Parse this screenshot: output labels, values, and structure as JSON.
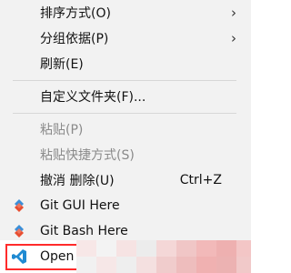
{
  "menu": {
    "items": [
      {
        "label": "排序方式(O)",
        "has_submenu": true
      },
      {
        "label": "分组依据(P)",
        "has_submenu": true
      },
      {
        "label": "刷新(E)"
      },
      {
        "label": "自定义文件夹(F)..."
      },
      {
        "label": "粘贴(P)",
        "disabled": true
      },
      {
        "label": "粘贴快捷方式(S)",
        "disabled": true
      },
      {
        "label": "撤消 删除(U)",
        "shortcut": "Ctrl+Z"
      },
      {
        "label": "Git GUI Here",
        "icon": "git-icon"
      },
      {
        "label": "Git Bash Here",
        "icon": "git-icon"
      },
      {
        "label": "Open",
        "icon": "vscode-icon"
      }
    ],
    "arrow_glyph": "›"
  },
  "colors": {
    "menu_bg": "#f2f2f2",
    "text": "#111111",
    "disabled_text": "#8a8a8a",
    "highlight_border": "#ff2b2b",
    "vscode_blue": "#1f8ad2",
    "git_red": "#e84e31",
    "git_blue": "#3c8fd8"
  }
}
